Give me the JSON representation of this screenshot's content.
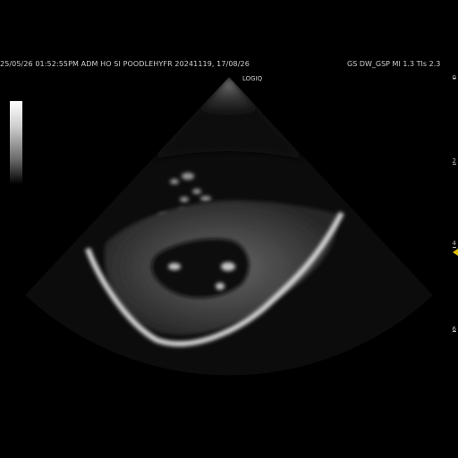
{
  "header": {
    "left_text": "25/05/26 01:52:55PM  ADM HO SI POODLEHYFR   20241119, 17/08/26",
    "right_text": "GS DW_GSP  MI 1.3  TIs 2.3",
    "logo": "LOGIQ"
  },
  "depth_scale": [
    {
      "label": "0"
    },
    {
      "label": "2"
    },
    {
      "label": "4"
    },
    {
      "label": "6"
    }
  ],
  "icons": {
    "grayscale_bar": "grayscale-bar",
    "focus_marker": "focus-marker",
    "focus_color": "#e0c000"
  }
}
